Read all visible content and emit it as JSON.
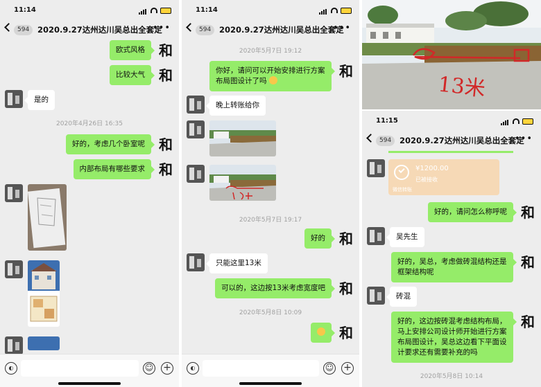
{
  "common": {
    "chat_title": "2020.9.27达州达川吴总出全套定",
    "unread_badge": "594",
    "right_avatar_char": "和"
  },
  "panel1": {
    "time": "11:14",
    "messages": [
      {
        "text": "欧式风格"
      },
      {
        "text": "比较大气"
      },
      {
        "text": "是的"
      },
      {
        "timestamp": "2020年4月26日 16:35"
      },
      {
        "text": "好的，考虑几个卧室呢"
      },
      {
        "text": "内部布局有哪些要求"
      }
    ]
  },
  "panel2": {
    "time": "11:14",
    "messages": [
      {
        "timestamp": "2020年5月7日 19:12"
      },
      {
        "text": "你好，请问可以开始安排进行方案布局图设计了吗"
      },
      {
        "text": "晚上转账给你"
      },
      {
        "timestamp": "2020年5月7日 19:17"
      },
      {
        "text": "好的"
      },
      {
        "text": "只能这里13米"
      },
      {
        "text": "可以的，这边按13米考虑宽度吧"
      },
      {
        "timestamp": "2020年5月8日 10:09"
      }
    ]
  },
  "panel3": {
    "time": "11:15",
    "photo_annotation": "13米",
    "payment": {
      "amount": "¥1200.00",
      "status": "已被接收",
      "footer": "微信转账"
    },
    "messages": [
      {
        "text": "好的，请问怎么称呼呢"
      },
      {
        "text": "吴先生"
      },
      {
        "text": "好的，吴总，考虑做砖混结构还是框架结构呢"
      },
      {
        "text": "砖混"
      },
      {
        "text": "好的，这边按砖混考虑结构布局，马上安排公司设计师开始进行方案布局图设计，吴总这边看下平面设计要求还有需要补充的吗"
      },
      {
        "timestamp": "2020年5月8日 10:14"
      }
    ]
  },
  "colors": {
    "bubble_green": "#95ec69",
    "chat_bg": "#ededed",
    "payment_bg": "#f6d9b6"
  },
  "icons": [
    "back-chevron-icon",
    "more-dots-icon",
    "voice-icon",
    "emoji-icon",
    "plus-icon",
    "signal-icon",
    "wifi-icon",
    "battery-icon"
  ]
}
